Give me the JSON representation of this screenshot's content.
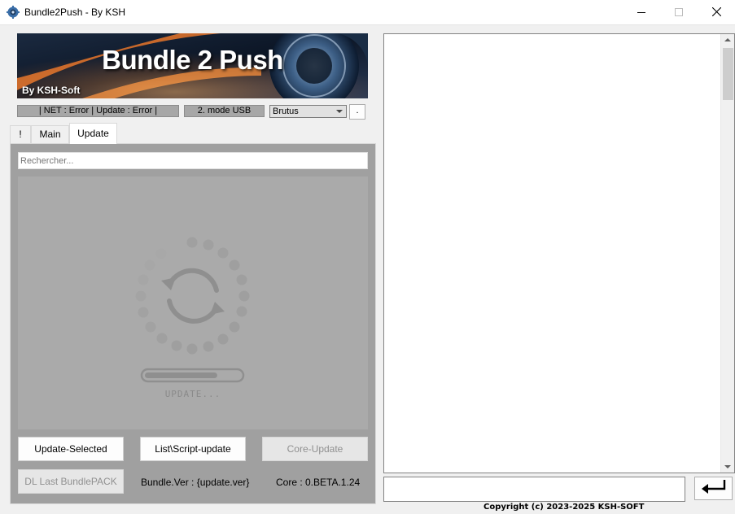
{
  "window": {
    "title": "Bundle2Push - By KSH",
    "controls": {
      "minimize": "minimize-icon",
      "maximize": "maximize-icon",
      "close": "close-icon"
    }
  },
  "banner": {
    "title": "Bundle 2 Push",
    "subtitle": "By KSH-Soft"
  },
  "status": {
    "net": "| NET : Error | Update : Error |",
    "mode": "2. mode USB",
    "profile": "Brutus",
    "dot_button": "."
  },
  "tabs": [
    {
      "label": "!"
    },
    {
      "label": "Main"
    },
    {
      "label": "Update",
      "active": true
    }
  ],
  "update_tab": {
    "search_placeholder": "Rechercher...",
    "loading_text": "UPDATE...",
    "progress": 0.76,
    "buttons": {
      "update_selected": "Update-Selected",
      "list_script_update": "List\\Script-update",
      "core_update": "Core-Update",
      "dl_last_bundlepack": "DL Last BundlePACK"
    },
    "bundle_ver": "Bundle.Ver : {update.ver}",
    "core_ver": "Core : 0.BETA.1.24"
  },
  "console": {
    "input_value": "",
    "enter_icon": "enter-icon"
  },
  "footer": {
    "copyright": "Copyright (c) 2023-2025 KSH-SOFT"
  },
  "colors": {
    "panel_gray": "#a0a0a0",
    "banner_orange": "#e8762a",
    "banner_dark": "#0c1a2e"
  }
}
